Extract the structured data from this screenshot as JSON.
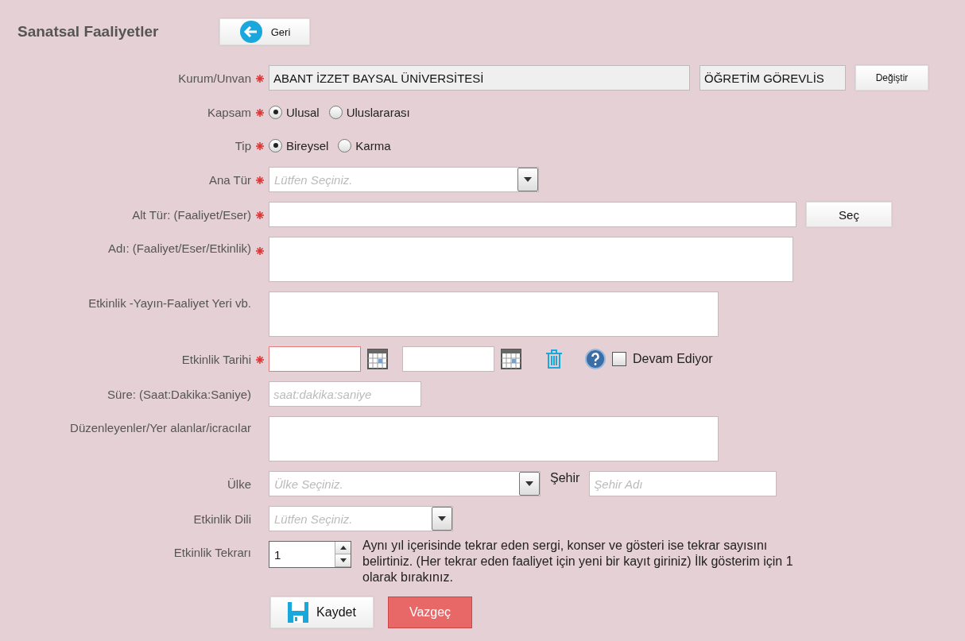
{
  "title": "Sanatsal Faaliyetler",
  "back_button": "Geri",
  "fields": [
    {
      "kind": "readonly_pair",
      "label": "Kurum/Unvan",
      "required": true,
      "value": "ABANT İZZET BAYSAL ÜNİVERSİTESİ",
      "value_2": "ÖĞRETİM GÖREVLİS",
      "button": "Değiştir"
    },
    {
      "kind": "radio",
      "label": "Kapsam",
      "required": true,
      "options": [
        {
          "label": "Ulusal",
          "selected": true
        },
        {
          "label": "Uluslararası",
          "selected": false
        }
      ]
    },
    {
      "kind": "radio",
      "label": "Tip",
      "required": true,
      "options": [
        {
          "label": "Bireysel",
          "selected": true
        },
        {
          "label": "Karma",
          "selected": false
        }
      ]
    },
    {
      "kind": "select",
      "label": "Ana Tür",
      "required": true,
      "placeholder": "Lütfen Seçiniz."
    },
    {
      "kind": "text_button",
      "label": "Alt Tür: (Faaliyet/Eser)",
      "required": true,
      "button": "Seç"
    },
    {
      "kind": "textarea",
      "label": "Adı: (Faaliyet/Eser/Etkinlik)",
      "required": true
    },
    {
      "kind": "textarea",
      "label": "Etkinlik -Yayın-Faaliyet Yeri vb.",
      "required": false
    },
    {
      "kind": "date_range",
      "label": "Etkinlik Tarihi",
      "required": true,
      "start_invalid": true,
      "checkbox_label": "Devam Ediyor",
      "checked": false
    },
    {
      "kind": "text",
      "label": "Süre: (Saat:Dakika:Saniye)",
      "required": false,
      "placeholder": "saat:dakika:saniye"
    },
    {
      "kind": "textarea",
      "label": "Düzenleyenler/Yer alanlar/icracılar",
      "required": false
    },
    {
      "kind": "country_city",
      "label": "Ülke",
      "required": false,
      "placeholder": "Ülke Seçiniz.",
      "city_label": "Şehir",
      "city_placeholder": "Şehir Adı"
    },
    {
      "kind": "select",
      "label": "Etkinlik Dili",
      "required": false,
      "placeholder": "Lütfen Seçiniz."
    },
    {
      "kind": "spinner",
      "label": "Etkinlik Tekrarı",
      "required": false,
      "value": "1",
      "help": "Aynı yıl içerisinde tekrar eden sergi, konser ve gösteri ise tekrar sayısını belirtiniz. (Her tekrar eden faaliyet için yeni bir kayıt giriniz) İlk gösterim için 1 olarak bırakınız."
    }
  ],
  "save_button": "Kaydet",
  "cancel_button": "Vazgeç"
}
